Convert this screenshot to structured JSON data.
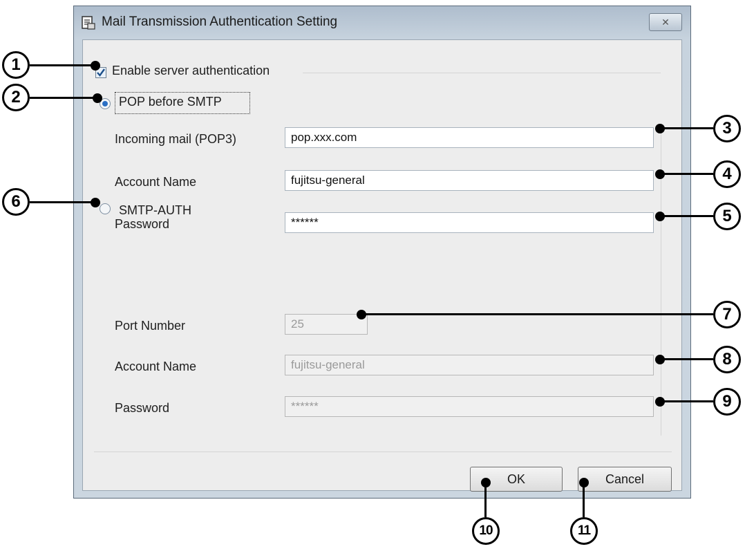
{
  "window": {
    "title": "Mail Transmission Authentication Setting",
    "close_label": "✕"
  },
  "auth": {
    "enable_label": "Enable server authentication",
    "enable_checked": true
  },
  "pop": {
    "label": "POP before SMTP",
    "selected": true,
    "incoming_label": "Incoming mail (POP3)",
    "incoming_value": "pop.xxx.com",
    "account_label": "Account Name",
    "account_value": "fujitsu-general",
    "password_label": "Password",
    "password_value": "******"
  },
  "smtp": {
    "label": "SMTP-AUTH",
    "selected": false,
    "port_label": "Port Number",
    "port_value": "25",
    "account_label": "Account Name",
    "account_value": "fujitsu-general",
    "password_label": "Password",
    "password_value": "******"
  },
  "buttons": {
    "ok": "OK",
    "cancel": "Cancel"
  },
  "callouts": [
    "1",
    "2",
    "3",
    "4",
    "5",
    "6",
    "7",
    "8",
    "9",
    "10",
    "11"
  ],
  "colors": {
    "radio_selected": "#2b6fc4",
    "titlebar": "#aebdcd"
  }
}
